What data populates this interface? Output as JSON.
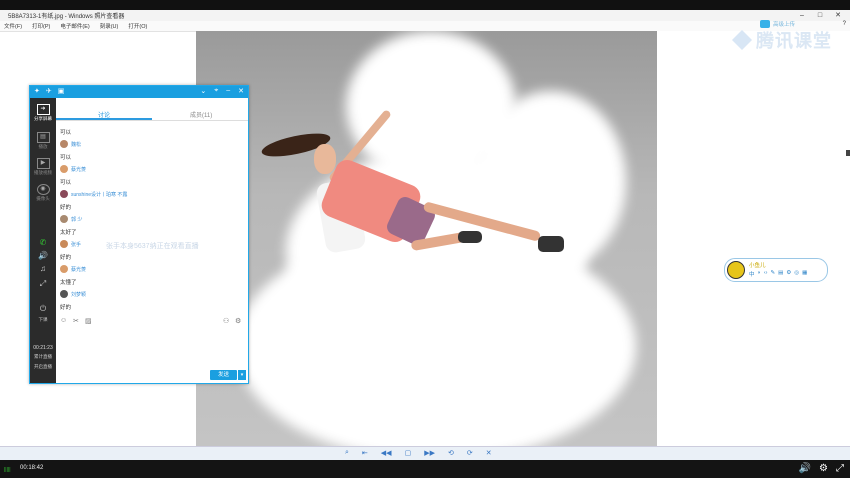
{
  "window": {
    "title": "5B8A7313-1有纸.jpg - Windows 照片查看器",
    "controls": [
      "–",
      "□",
      "✕"
    ]
  },
  "menu": {
    "items": [
      "文件(F)",
      "打印(P)",
      "电子邮件(E)",
      "刻录(U)",
      "打开(O)"
    ],
    "help": "?"
  },
  "logo": {
    "text": "腾讯课堂"
  },
  "tag": {
    "text": "高级上传"
  },
  "chat": {
    "tabs": [
      {
        "label": "讨论"
      },
      {
        "label": "成员(11)"
      }
    ],
    "sidebar": {
      "share_label": "分享屏幕",
      "play_label": "播放",
      "video_label": "播放视频",
      "camera_label": "摄像头",
      "end_label": "下课",
      "elapsed_time": "00:21:23",
      "elapsed_label": "累计直播",
      "rec_label": "开启直播"
    },
    "messages": [
      {
        "text": "可以"
      },
      {
        "name": "魏松",
        "text": "可以"
      },
      {
        "name": "蔡光菱",
        "text": "可以"
      },
      {
        "name": "sunshine设计丨珀寒 不露",
        "text": "好的"
      },
      {
        "name": "郭 少",
        "text": "太好了"
      },
      {
        "name": "张手",
        "text": "好的"
      },
      {
        "name": "蔡光菱",
        "text": "太懂了"
      },
      {
        "name": "刘梦颖",
        "text": "好的"
      }
    ],
    "watermark": "张手本身5637纳正在观看直播",
    "send_label": "发送",
    "send_arrow": "▾"
  },
  "widget": {
    "name": "小鱼儿",
    "icons": [
      "中",
      "◗",
      "‹›",
      "✎",
      "▤",
      "⚙",
      "◎",
      "▦"
    ]
  },
  "playback": {
    "controls": [
      "⌕",
      "⇤",
      "◀◀",
      "▢",
      "▶▶",
      "⟲",
      "⟳",
      "✕"
    ]
  },
  "video": {
    "progress": "|||||",
    "time": "00:18:42",
    "icons": [
      "🔊",
      "⚙",
      "⤢"
    ]
  }
}
